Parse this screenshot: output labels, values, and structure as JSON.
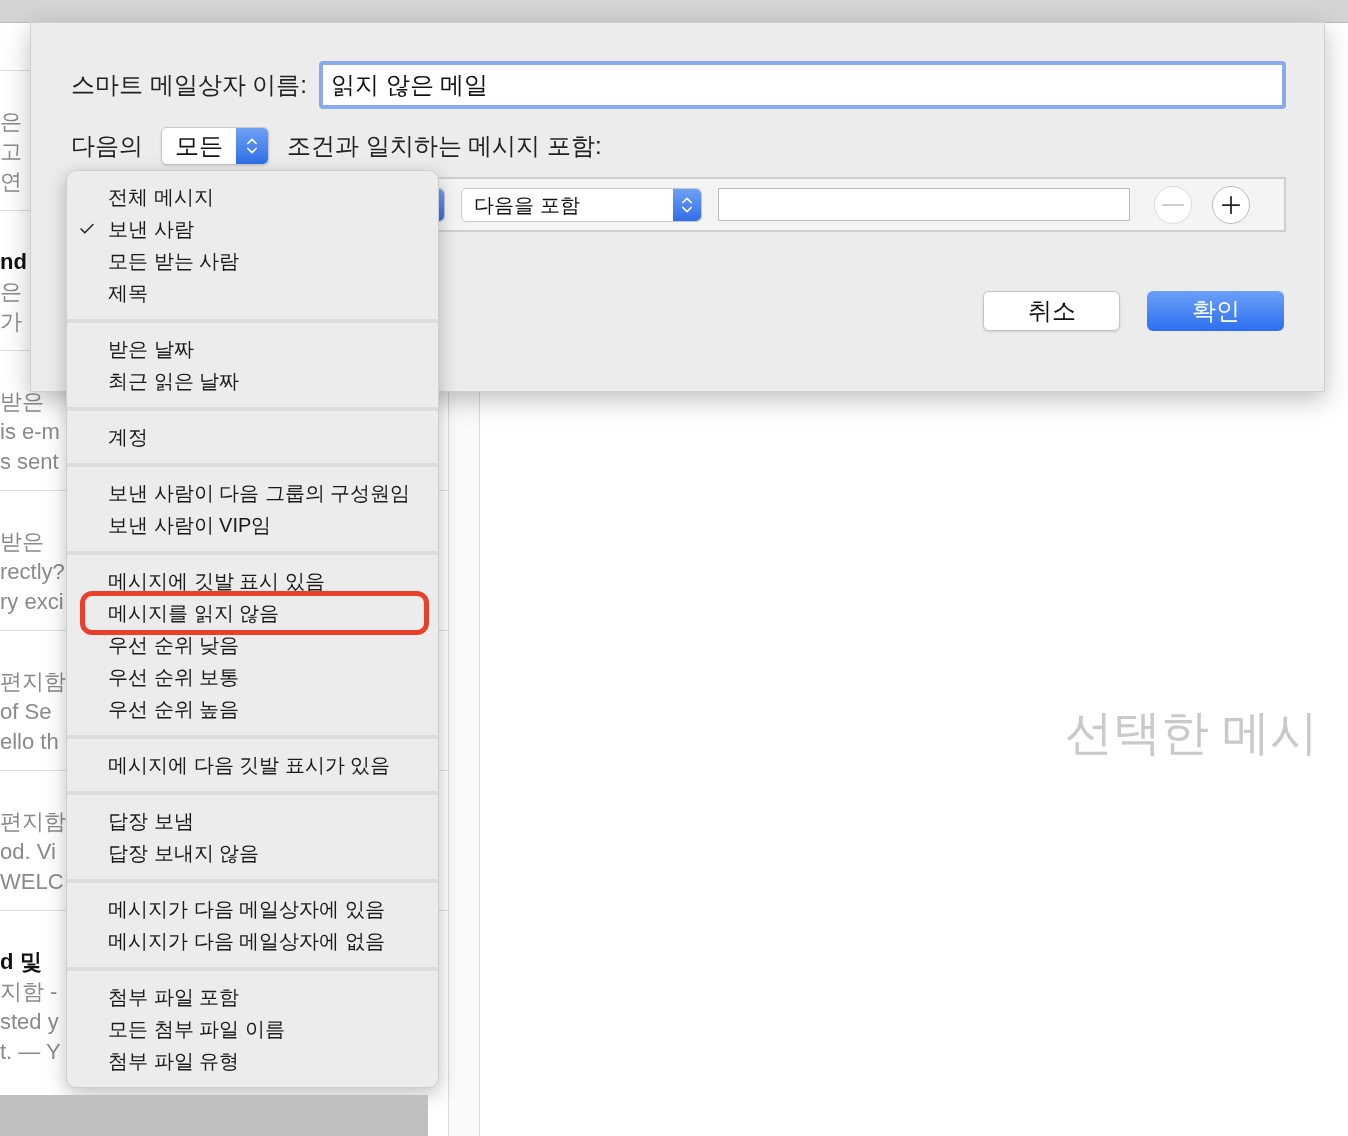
{
  "mail_list": [
    {
      "lines": [
        {
          "text": "은",
          "bold": false
        },
        {
          "text": "고",
          "bold": false
        },
        {
          "text": "연",
          "bold": false
        }
      ]
    },
    {
      "lines": [
        {
          "text": "nd",
          "bold": true
        },
        {
          "text": "은",
          "bold": false
        },
        {
          "text": "가",
          "bold": false
        }
      ]
    },
    {
      "lines": [
        {
          "text": "받은",
          "bold": false
        },
        {
          "text": "is e-m",
          "bold": false
        },
        {
          "text": "s sent",
          "bold": false
        }
      ]
    },
    {
      "lines": [
        {
          "text": "받은",
          "bold": false
        },
        {
          "text": "rectly?",
          "bold": false
        },
        {
          "text": "ry exci",
          "bold": false
        }
      ]
    },
    {
      "lines": [
        {
          "text": "편지함",
          "bold": false
        },
        {
          "text": "of Se",
          "bold": false
        },
        {
          "text": "ello th",
          "bold": false
        }
      ]
    },
    {
      "lines": [
        {
          "text": "편지함",
          "bold": false
        },
        {
          "text": "od. Vi",
          "bold": false
        },
        {
          "text": "WELC",
          "bold": false
        }
      ]
    },
    {
      "lines": [
        {
          "text": "d 및",
          "bold": true
        },
        {
          "text": "지함 -",
          "bold": false
        },
        {
          "text": "sted y",
          "bold": false
        },
        {
          "text": "t. — Y",
          "bold": false
        }
      ]
    }
  ],
  "preview_placeholder": "선택한 메시",
  "dialog": {
    "name_label": "스마트 메일상자 이름:",
    "name_value": "읽지 않은 메일",
    "match_prefix": "다음의",
    "match_popup": "모든",
    "match_suffix": "조건과 일치하는 메시지 포함:",
    "rule": {
      "operator": "다음을 포함"
    },
    "buttons": [
      {
        "label": "취소",
        "default": false
      },
      {
        "label": "확인",
        "default": true
      }
    ]
  },
  "menu": {
    "groups": [
      {
        "items": [
          {
            "label": "전체 메시지",
            "checked": false,
            "highlighted": false
          },
          {
            "label": "보낸 사람",
            "checked": true,
            "highlighted": false
          },
          {
            "label": "모든 받는 사람",
            "checked": false,
            "highlighted": false
          },
          {
            "label": "제목",
            "checked": false,
            "highlighted": false
          }
        ]
      },
      {
        "items": [
          {
            "label": "받은 날짜",
            "checked": false,
            "highlighted": false
          },
          {
            "label": "최근 읽은 날짜",
            "checked": false,
            "highlighted": false
          }
        ]
      },
      {
        "items": [
          {
            "label": "계정",
            "checked": false,
            "highlighted": false
          }
        ]
      },
      {
        "items": [
          {
            "label": "보낸 사람이 다음 그룹의 구성원임",
            "checked": false,
            "highlighted": false
          },
          {
            "label": "보낸 사람이 VIP임",
            "checked": false,
            "highlighted": false
          }
        ]
      },
      {
        "items": [
          {
            "label": "메시지에 깃발 표시 있음",
            "checked": false,
            "highlighted": false
          },
          {
            "label": "메시지를 읽지 않음",
            "checked": false,
            "highlighted": true
          },
          {
            "label": "우선 순위 낮음",
            "checked": false,
            "highlighted": false
          },
          {
            "label": "우선 순위 보통",
            "checked": false,
            "highlighted": false
          },
          {
            "label": "우선 순위 높음",
            "checked": false,
            "highlighted": false
          }
        ]
      },
      {
        "items": [
          {
            "label": "메시지에 다음 깃발 표시가 있음",
            "checked": false,
            "highlighted": false
          }
        ]
      },
      {
        "items": [
          {
            "label": "답장 보냄",
            "checked": false,
            "highlighted": false
          },
          {
            "label": "답장 보내지 않음",
            "checked": false,
            "highlighted": false
          }
        ]
      },
      {
        "items": [
          {
            "label": "메시지가 다음 메일상자에 있음",
            "checked": false,
            "highlighted": false
          },
          {
            "label": "메시지가 다음 메일상자에 없음",
            "checked": false,
            "highlighted": false
          }
        ]
      },
      {
        "items": [
          {
            "label": "첨부 파일 포함",
            "checked": false,
            "highlighted": false
          },
          {
            "label": "모든 첨부 파일 이름",
            "checked": false,
            "highlighted": false
          },
          {
            "label": "첨부 파일 유형",
            "checked": false,
            "highlighted": false
          }
        ]
      }
    ]
  }
}
